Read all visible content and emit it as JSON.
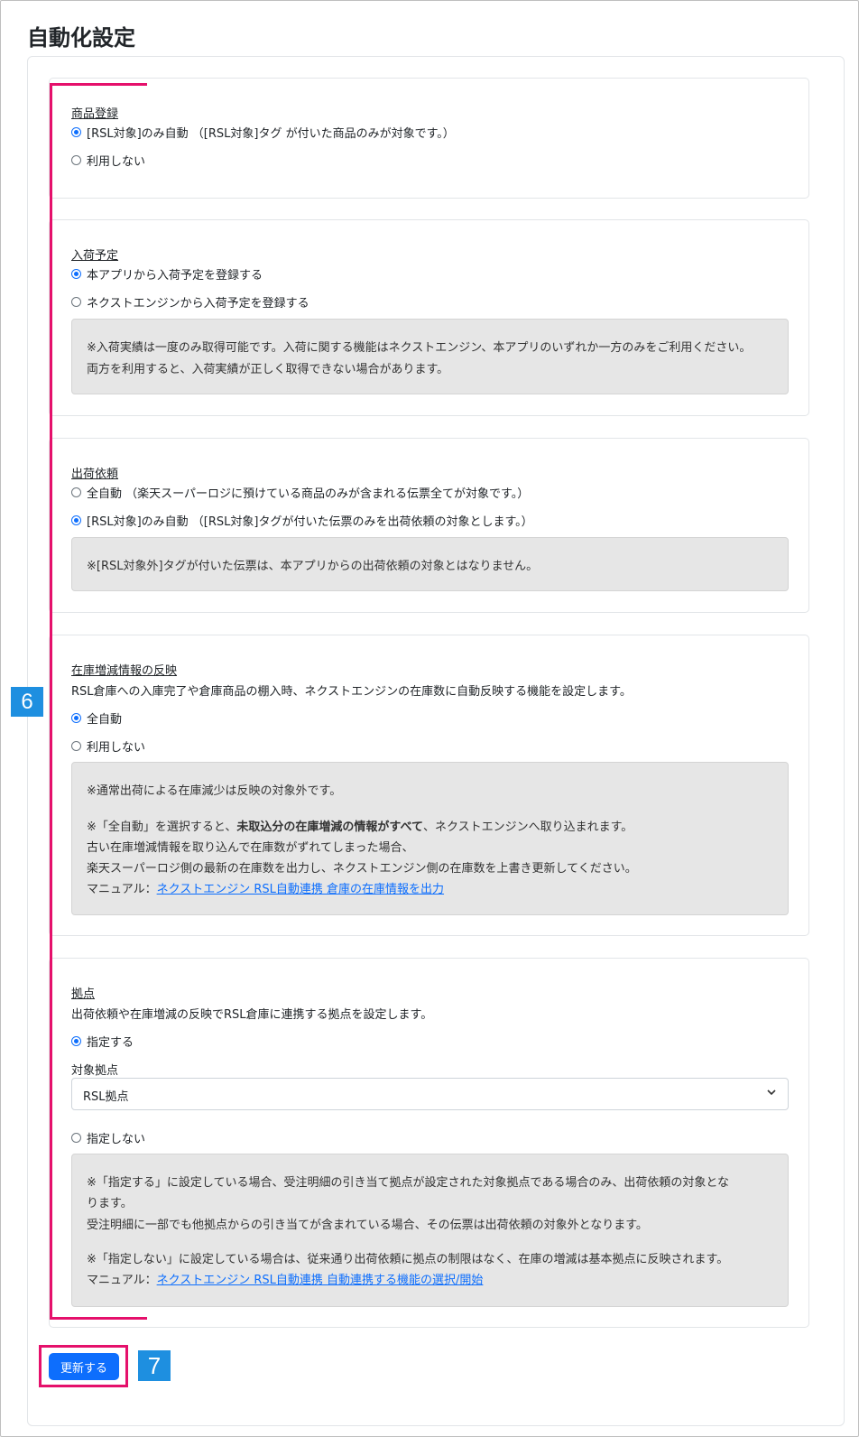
{
  "page_title": "自動化設定",
  "sections": {
    "product": {
      "title": "商品登録",
      "options": [
        {
          "label": "[RSL対象]のみ自動 （[RSL対象]タグ が付いた商品のみが対象です。）",
          "checked": true
        },
        {
          "label": "利用しない",
          "checked": false
        }
      ]
    },
    "arrival": {
      "title": "入荷予定",
      "options": [
        {
          "label": "本アプリから入荷予定を登録する",
          "checked": true
        },
        {
          "label": "ネクストエンジンから入荷予定を登録する",
          "checked": false
        }
      ],
      "note": [
        "※入荷実績は一度のみ取得可能です。入荷に関する機能はネクストエンジン、本アプリのいずれか一方のみをご利用ください。",
        "両方を利用すると、入荷実績が正しく取得できない場合があります。"
      ]
    },
    "shipping": {
      "title": "出荷依頼",
      "options": [
        {
          "label": "全自動 （楽天スーパーロジに預けている商品のみが含まれる伝票全てが対象です。）",
          "checked": false
        },
        {
          "label": "[RSL対象]のみ自動 （[RSL対象]タグが付いた伝票のみを出荷依頼の対象とします。）",
          "checked": true
        }
      ],
      "note": [
        "※[RSL対象外]タグが付いた伝票は、本アプリからの出荷依頼の対象とはなりません。"
      ]
    },
    "stock": {
      "title": "在庫増減情報の反映",
      "desc": "RSL倉庫への入庫完了や倉庫商品の棚入時、ネクストエンジンの在庫数に自動反映する機能を設定します。",
      "options": [
        {
          "label": "全自動",
          "checked": true
        },
        {
          "label": "利用しない",
          "checked": false
        }
      ],
      "note_line1": "※通常出荷による在庫減少は反映の対象外です。",
      "note_line2_pre": "※「全自動」を選択すると、",
      "note_line2_bold": "未取込分の在庫増減の情報がすべて",
      "note_line2_post": "、ネクストエンジンへ取り込まれます。",
      "note_line3": "古い在庫増減情報を取り込んで在庫数がずれてしまった場合、",
      "note_line4": "楽天スーパーロジ側の最新の在庫数を出力し、ネクストエンジン側の在庫数を上書き更新してください。",
      "manual_label": "マニュアル：",
      "manual_link": "ネクストエンジン RSL自動連携 倉庫の在庫情報を出力"
    },
    "base": {
      "title": "拠点",
      "desc": "出荷依頼や在庫増減の反映でRSL倉庫に連携する拠点を設定します。",
      "option_specify": {
        "label": "指定する",
        "checked": true
      },
      "target_label": "対象拠点",
      "target_value": "RSL拠点",
      "option_none": {
        "label": "指定しない",
        "checked": false
      },
      "note_line1": "※「指定する」に設定している場合、受注明細の引き当て拠点が設定された対象拠点である場合のみ、出荷依頼の対象とな",
      "note_line2": "ります。",
      "note_line3": "受注明細に一部でも他拠点からの引き当てが含まれている場合、その伝票は出荷依頼の対象外となります。",
      "note_line4": "※「指定しない」に設定している場合は、従来通り出荷依頼に拠点の制限はなく、在庫の増減は基本拠点に反映されます。",
      "manual_label": "マニュアル：",
      "manual_link": "ネクストエンジン RSL自動連携 自動連携する機能の選択/開始"
    }
  },
  "update_button": "更新する",
  "callouts": {
    "six": "6",
    "seven": "7"
  },
  "colors": {
    "accent": "#0d6efd",
    "highlight": "#e5106b",
    "callout": "#1e8fe0",
    "note_bg": "#e6e6e6"
  }
}
